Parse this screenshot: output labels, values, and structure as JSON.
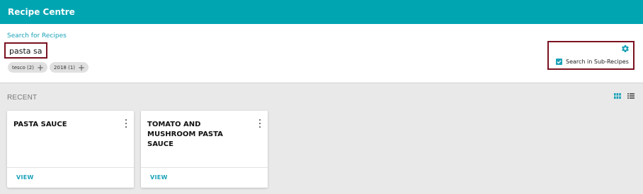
{
  "app": {
    "title": "Recipe Centre"
  },
  "search": {
    "label": "Search for Recipes",
    "value": "pasta sa",
    "filters": [
      {
        "label": "tesco (2)"
      },
      {
        "label": "2018 (1)"
      }
    ],
    "settings": {
      "icon": "gear-icon",
      "sub_recipes_label": "Search in Sub-Recipes",
      "sub_recipes_checked": true
    }
  },
  "recent": {
    "label": "RECENT",
    "view_modes": [
      "grid-view-icon",
      "list-view-icon"
    ],
    "cards": [
      {
        "title": "PASTA SAUCE",
        "action": "VIEW"
      },
      {
        "title": "TOMATO AND MUSHROOM PASTA SAUCE",
        "action": "VIEW"
      }
    ]
  },
  "colors": {
    "accent": "#00a5b2",
    "highlight_border": "#7a1120",
    "background": "#e9e9e9"
  }
}
